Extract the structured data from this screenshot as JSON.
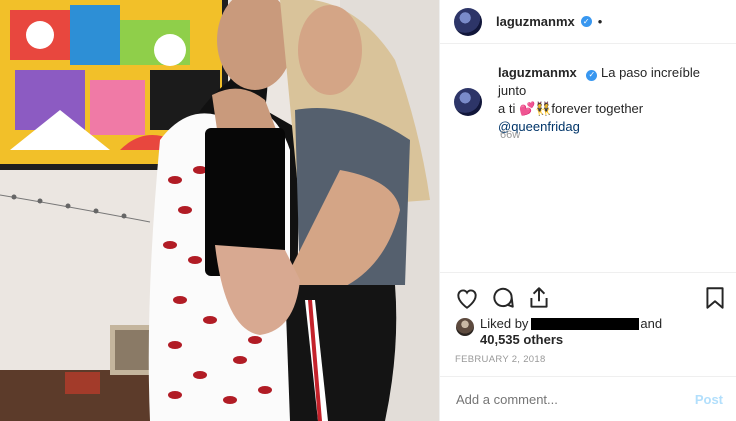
{
  "post": {
    "username": "laguzmanmx",
    "verified_icon": "verified-badge-icon",
    "header_separator": "•",
    "caption": {
      "username": "laguzmanmx",
      "text_line1": "La paso increíble junto",
      "text_line2_prefix": "a ti ",
      "text_line2_emojis": "💕👯",
      "text_line2_suffix": "forever together",
      "mention": "@queenfridag"
    },
    "time_ago": "66w"
  },
  "actions": {
    "like_icon": "heart-icon",
    "comment_icon": "comment-icon",
    "share_icon": "share-icon",
    "save_icon": "bookmark-icon"
  },
  "likes": {
    "prefix": "Liked by",
    "suffix": "and",
    "count_text": "40,535 others"
  },
  "date": "FEBRUARY 2, 2018",
  "comment": {
    "placeholder": "Add a comment...",
    "post_label": "Post"
  },
  "colors": {
    "accent": "#3897f0",
    "post_disabled": "#b2dffc",
    "mention": "#003569",
    "muted": "#999999"
  }
}
